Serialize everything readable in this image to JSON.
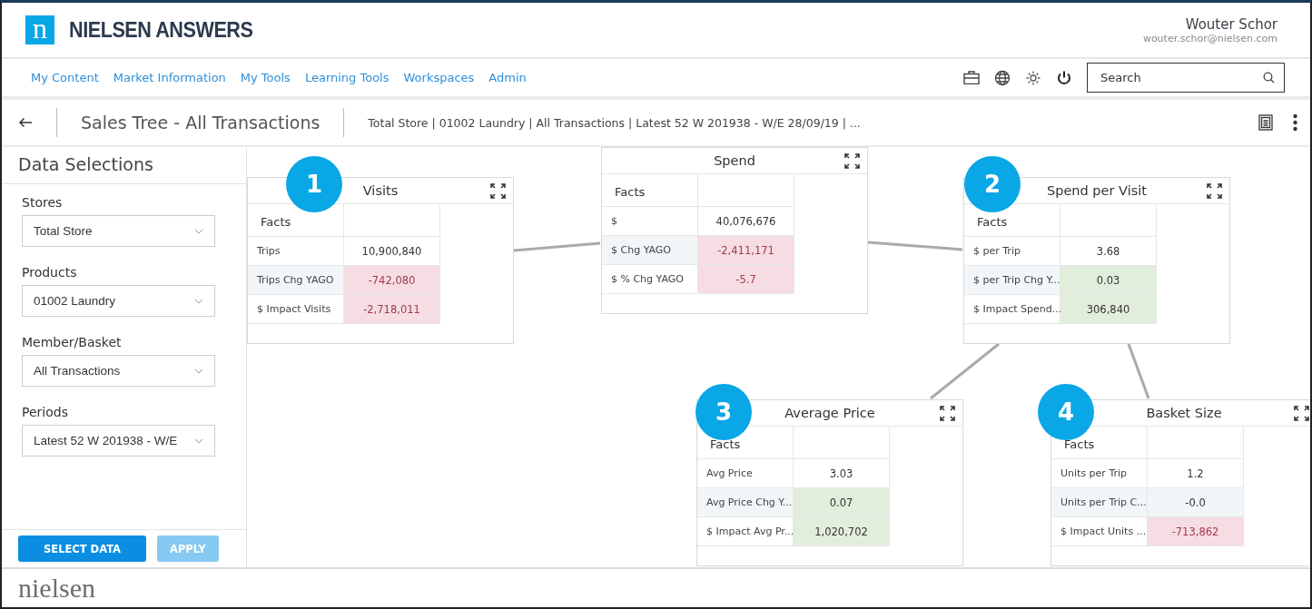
{
  "brand": {
    "logo_letter": "n",
    "name": "NIELSEN ANSWERS"
  },
  "user": {
    "name": "Wouter Schor",
    "email": "wouter.schor@nielsen.com"
  },
  "nav": [
    "My Content",
    "Market Information",
    "My Tools",
    "Learning Tools",
    "Workspaces",
    "Admin"
  ],
  "search": {
    "placeholder": "Search"
  },
  "title_bar": {
    "title": "Sales Tree - All Transactions",
    "breadcrumb": "Total Store | 01002 Laundry | All Transactions | Latest 52 W 201938 - W/E 28/09/19 | ..."
  },
  "sidebar": {
    "title": "Data Selections",
    "fields": [
      {
        "label": "Stores",
        "value": "Total Store"
      },
      {
        "label": "Products",
        "value": "01002 Laundry"
      },
      {
        "label": "Member/Basket",
        "value": "All Transactions"
      },
      {
        "label": "Periods",
        "value": "Latest 52 W 201938 - W/E"
      }
    ],
    "buttons": [
      {
        "label": "SELECT DATA",
        "disabled": false
      },
      {
        "label": "APPLY",
        "disabled": true
      }
    ]
  },
  "tree": [
    {
      "badge": "1",
      "title": "Visits",
      "header": "Facts",
      "rows": [
        {
          "label": "Trips",
          "value": "10,900,840",
          "color": "#ffffff"
        },
        {
          "label": "Trips Chg YAGO",
          "value": "-742,080",
          "color": "#f5dde3"
        },
        {
          "label": "$ Impact Visits",
          "value": "-2,718,011",
          "color": "#f5dde3"
        }
      ]
    },
    {
      "title": "Spend",
      "header": "Facts",
      "rows": [
        {
          "label": "$",
          "value": "40,076,676",
          "color": "#ffffff"
        },
        {
          "label": "$ Chg YAGO",
          "value": "-2,411,171",
          "color": "#f5dde3"
        },
        {
          "label": "$ % Chg YAGO",
          "value": "-5.7",
          "color": "#f5dde3"
        }
      ]
    },
    {
      "badge": "2",
      "title": "Spend per Visit",
      "header": "Facts",
      "rows": [
        {
          "label": "$ per Trip",
          "value": "3.68",
          "color": "#ffffff"
        },
        {
          "label": "$ per Trip Chg Y...",
          "value": "0.03",
          "color": "#e2eedc"
        },
        {
          "label": "$ Impact Spend...",
          "value": "306,840",
          "color": "#e2eedc"
        }
      ]
    },
    {
      "badge": "3",
      "title": "Average Price",
      "header": "Facts",
      "rows": [
        {
          "label": "Avg Price",
          "value": "3.03",
          "color": "#ffffff"
        },
        {
          "label": "Avg Price Chg Y...",
          "value": "0.07",
          "color": "#e2eedc"
        },
        {
          "label": "$ Impact Avg Pr...",
          "value": "1,020,702",
          "color": "#e2eedc"
        }
      ]
    },
    {
      "badge": "4",
      "title": "Basket Size",
      "header": "Facts",
      "rows": [
        {
          "label": "Units per Trip",
          "value": "1.2",
          "color": "#ffffff"
        },
        {
          "label": "Units per Trip C...",
          "value": "-0.0",
          "color": "#f2f6f9"
        },
        {
          "label": "$ Impact Units ...",
          "value": "-713,862",
          "color": "#f5dde3"
        }
      ]
    }
  ],
  "footer": {
    "logo": "nielsen"
  }
}
